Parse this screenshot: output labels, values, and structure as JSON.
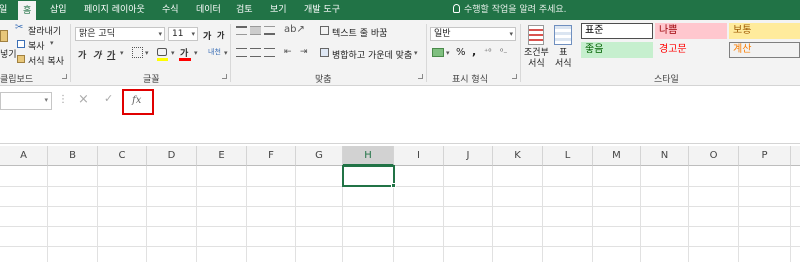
{
  "menu": {
    "tabs": [
      {
        "label": "일",
        "active": false
      },
      {
        "label": "홈",
        "active": true
      },
      {
        "label": "삽입",
        "active": false
      },
      {
        "label": "페이지 레이아웃",
        "active": false
      },
      {
        "label": "수식",
        "active": false
      },
      {
        "label": "데이터",
        "active": false
      },
      {
        "label": "검토",
        "active": false
      },
      {
        "label": "보기",
        "active": false
      },
      {
        "label": "개발 도구",
        "active": false
      }
    ],
    "tell_me": "수행할 작업을 알려 주세요."
  },
  "ribbon": {
    "clipboard": {
      "paste_label": "넣기",
      "cut_label": "잘라내기",
      "copy_label": "복사",
      "format_painter_label": "서식 복사",
      "group_label": "클립보드"
    },
    "font": {
      "font_name": "맑은 고딕",
      "font_size": "11",
      "grow_label": "가",
      "shrink_label": "가",
      "bold": "가",
      "italic": "가",
      "underline": "가",
      "font_color_glyph": "가",
      "phonetic_label": "내천",
      "group_label": "글꼴"
    },
    "alignment": {
      "wrap_text_label": "텍스트 줄 바꿈",
      "merge_label": "병합하고 가운데 맞춤",
      "group_label": "맞춤"
    },
    "number": {
      "format": "일반",
      "percent": "%",
      "comma": ",",
      "group_label": "표시 형식"
    },
    "styles": {
      "cond_format_label": "조건부\n서식",
      "table_format_label": "표\n서식",
      "cells": [
        {
          "label": "표준",
          "bg": "#ffffff",
          "fg": "#000000",
          "border": "#4e4e4e"
        },
        {
          "label": "나쁨",
          "bg": "#ffc7ce",
          "fg": "#9c0006",
          "border": "#ffc7ce"
        },
        {
          "label": "보통",
          "bg": "#ffeb9c",
          "fg": "#9c5700",
          "border": "#ffeb9c"
        },
        {
          "label": "좋음",
          "bg": "#c6efce",
          "fg": "#006100",
          "border": "#c6efce"
        },
        {
          "label": "경고문",
          "bg": "#f3f3f3",
          "fg": "#ff0000",
          "border": "#f3f3f3"
        },
        {
          "label": "계산",
          "bg": "#f2f2f2",
          "fg": "#fa7d00",
          "border": "#7f7f7f"
        }
      ],
      "group_label": "스타일"
    }
  },
  "formula_bar": {
    "name_box": "",
    "cancel_icon": "×",
    "enter_icon": "✓",
    "fx_label": "fx",
    "formula": ""
  },
  "grid": {
    "columns": [
      "A",
      "B",
      "C",
      "D",
      "E",
      "F",
      "G",
      "H",
      "I",
      "J",
      "K",
      "L",
      "M",
      "N",
      "O",
      "P"
    ],
    "selected_column": "H",
    "active_cell": "H1"
  },
  "colors": {
    "accent": "#217346",
    "highlight": "#e00000"
  }
}
